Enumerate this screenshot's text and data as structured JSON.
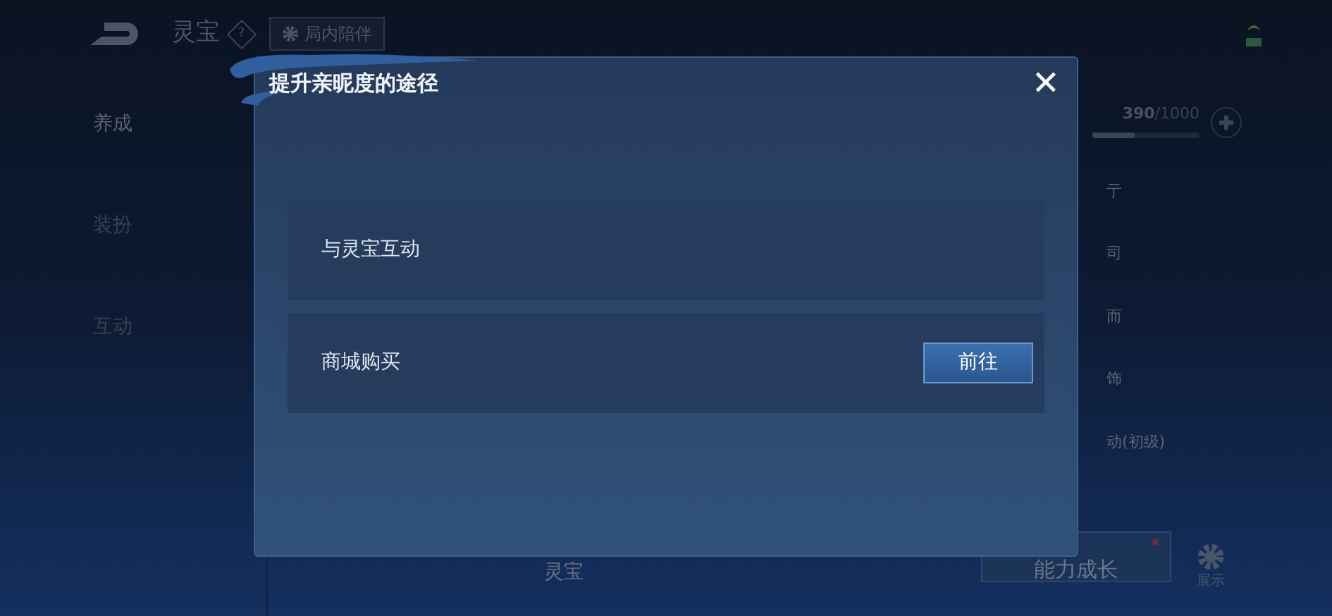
{
  "header": {
    "title": "灵宝",
    "help": "?",
    "companion_button": "局内陪伴"
  },
  "sidebar": {
    "items": [
      {
        "label": "养成",
        "selected": true
      },
      {
        "label": "装扮",
        "selected": false
      },
      {
        "label": "互动",
        "selected": false
      }
    ]
  },
  "intimacy": {
    "value": "390",
    "max": "/1000",
    "level": 0.39
  },
  "right_list": [
    "亍",
    "司",
    "而",
    "饰",
    "动(初级)"
  ],
  "bottom": {
    "name": "灵宝",
    "growth_button": "能力成长",
    "display": "展示"
  },
  "dialog": {
    "title": "提升亲昵度的途径",
    "close": "✕",
    "rows": [
      {
        "label": "与灵宝互动"
      },
      {
        "label": "商城购买",
        "button": "前往"
      }
    ]
  }
}
